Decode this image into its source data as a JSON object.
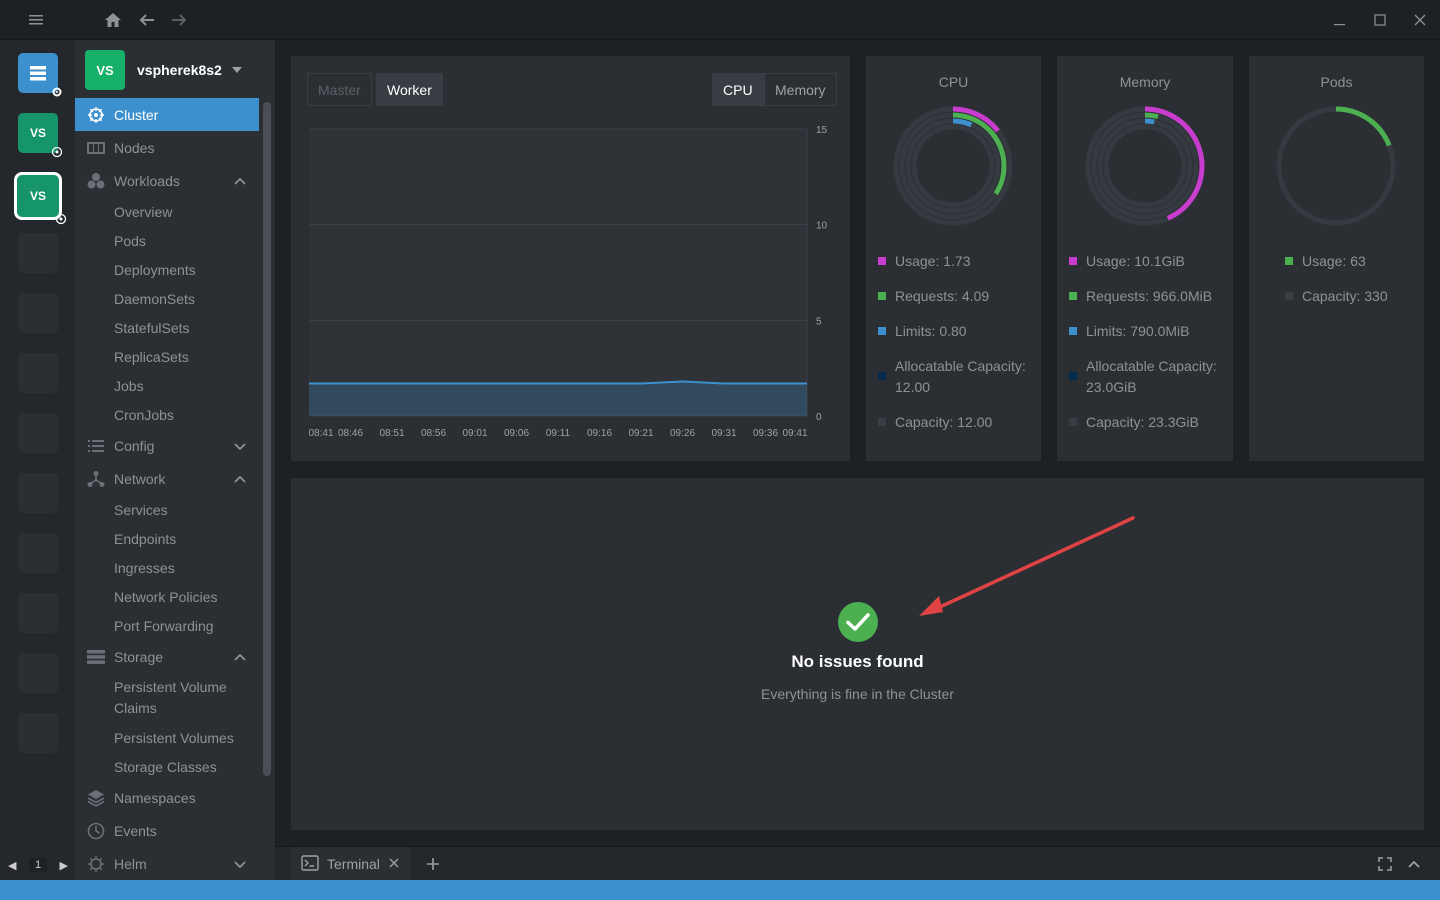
{
  "hotbar": {
    "clusters": [
      {
        "label": "VS"
      },
      {
        "label": "VS"
      }
    ],
    "page": "1"
  },
  "sidebar": {
    "cluster_avatar": "VS",
    "cluster_name": "vspherek8s2",
    "nav": {
      "cluster": "Cluster",
      "nodes": "Nodes",
      "workloads": "Workloads",
      "workloads_items": [
        "Overview",
        "Pods",
        "Deployments",
        "DaemonSets",
        "StatefulSets",
        "ReplicaSets",
        "Jobs",
        "CronJobs"
      ],
      "config": "Config",
      "network": "Network",
      "network_items": [
        "Services",
        "Endpoints",
        "Ingresses",
        "Network Policies",
        "Port Forwarding"
      ],
      "storage": "Storage",
      "storage_items": [
        "Persistent Volume Claims",
        "Persistent Volumes",
        "Storage Classes"
      ],
      "namespaces": "Namespaces",
      "events": "Events",
      "helm": "Helm"
    }
  },
  "metrics": {
    "node_tabs": {
      "master": "Master",
      "worker": "Worker"
    },
    "metric_tabs": {
      "cpu": "CPU",
      "memory": "Memory"
    }
  },
  "chart_data": {
    "type": "area",
    "title": "",
    "xlabel": "",
    "ylabel": "",
    "ylim": [
      0,
      15
    ],
    "yticks": [
      "15",
      "10",
      "5",
      "0"
    ],
    "x": [
      "08:41",
      "08:46",
      "08:51",
      "08:56",
      "09:01",
      "09:06",
      "09:11",
      "09:16",
      "09:21",
      "09:26",
      "09:31",
      "09:36",
      "09:41"
    ],
    "series": [
      {
        "values": [
          1.7,
          1.7,
          1.7,
          1.7,
          1.7,
          1.7,
          1.7,
          1.7,
          1.7,
          1.8,
          1.7,
          1.7,
          1.7
        ]
      }
    ],
    "color": "#3d90ce"
  },
  "stats": {
    "cpu": {
      "title": "CPU",
      "usage": "Usage: 1.73",
      "requests": "Requests: 4.09",
      "limits": "Limits: 0.80",
      "allocatable": "Allocatable Capacity: 12.00",
      "capacity": "Capacity: 12.00",
      "usage_frac": 0.144,
      "requests_frac": 0.341,
      "limits_frac": 0.067
    },
    "memory": {
      "title": "Memory",
      "usage": "Usage: 10.1GiB",
      "requests": "Requests: 966.0MiB",
      "limits": "Limits: 790.0MiB",
      "allocatable": "Allocatable Capacity: 23.0GiB",
      "capacity": "Capacity: 23.3GiB",
      "usage_frac": 0.434,
      "requests_frac": 0.041,
      "limits_frac": 0.033
    },
    "pods": {
      "title": "Pods",
      "usage": "Usage: 63",
      "capacity": "Capacity: 330",
      "usage_frac": 0.191
    },
    "colors": {
      "usage": "#c93dce",
      "requests": "#4caf50",
      "limits": "#3d90ce",
      "allocatable": "#032b4d",
      "capacity": "#3a3e44"
    }
  },
  "issues": {
    "title": "No issues found",
    "subtitle": "Everything is fine in the Cluster"
  },
  "dock": {
    "terminal_label": "Terminal"
  }
}
